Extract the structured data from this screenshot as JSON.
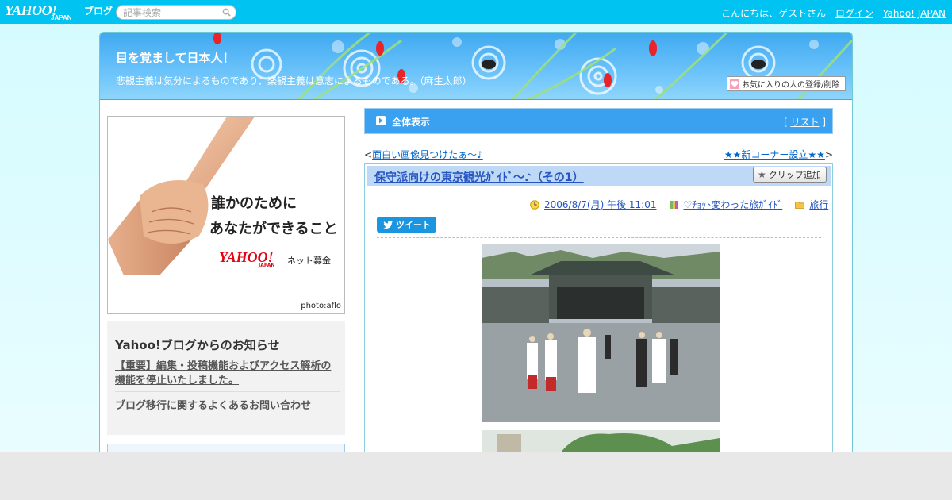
{
  "header": {
    "logo_yahoo": "YAHOO!",
    "logo_japan": "JAPAN",
    "logo_blog": "ブログ",
    "search_placeholder": "記事検索",
    "greeting": "こんにちは、ゲストさん",
    "login": "ログイン",
    "yahoo_japan": "Yahoo! JAPAN"
  },
  "blog": {
    "title": "目を覚まして日本人！",
    "subtitle": "悲観主義は気分によるものであり、楽観主義は意志によるものである。（麻生太郎）",
    "favorite_button": "お気に入りの人の登録/削除"
  },
  "ad": {
    "line1": "誰かのために",
    "line2": "あなたができること",
    "logo": "YAHOO!",
    "logo_japan": "JAPAN",
    "service": "ネット募金",
    "credit": "photo:aflo"
  },
  "notice": {
    "heading": "Yahoo!ブログからのお知らせ",
    "items": [
      "【重要】編集・投稿機能およびアクセス解析の機能を停止いたしました。",
      "ブログ移行に関するよくあるお問い合わせ"
    ]
  },
  "main": {
    "view_all": "全体表示",
    "list_open": "[",
    "list_link": "リスト",
    "list_close": "]",
    "prev_arrow": "<",
    "prev_link": "面白い画像見つけたぁ～♪",
    "next_link": "★★新コーナー設立★★",
    "next_arrow": ">"
  },
  "article": {
    "title": "保守派向けの東京観光ｶﾞｲﾄﾞ～♪（その1）",
    "clip_button": "クリップ追加",
    "date": "2006/8/7(月) 午後 11:01",
    "category": "♡ﾁｮｯﾄ変わった旅ｶﾞｲﾄﾞ",
    "folder": "旅行",
    "tweet": "ツイート"
  },
  "icons": {
    "search": "search-icon",
    "arrow": "arrow-right-icon",
    "clock": "clock-icon",
    "book": "book-icon",
    "folder": "folder-icon",
    "star": "star-icon",
    "bird": "twitter-bird-icon",
    "heart": "heart-icon"
  },
  "colors": {
    "topbar": "#00c3f2",
    "banner": "#3fa9f0",
    "link": "#2655c2",
    "tweet": "#1b95e0"
  }
}
